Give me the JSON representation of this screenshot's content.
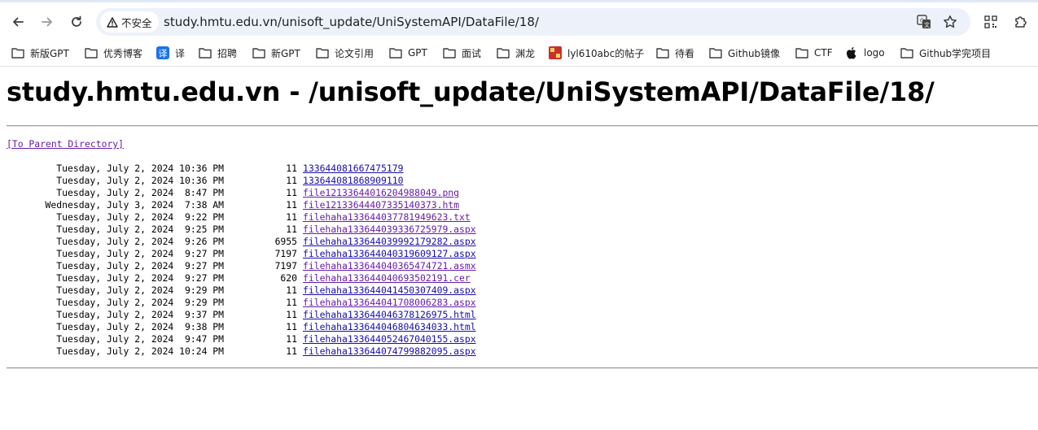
{
  "browser": {
    "security_chip": "不安全",
    "url": "study.hmtu.edu.vn/unisoft_update/UniSystemAPI/DataFile/18/"
  },
  "bookmarks": [
    {
      "label": "新版GPT",
      "icon": "folder-icon"
    },
    {
      "label": "优秀博客",
      "icon": "folder-icon"
    },
    {
      "label": "译",
      "icon": "translate-icon"
    },
    {
      "label": "招聘",
      "icon": "folder-icon"
    },
    {
      "label": "新GPT",
      "icon": "folder-icon"
    },
    {
      "label": "论文引用",
      "icon": "folder-icon"
    },
    {
      "label": "GPT",
      "icon": "folder-icon"
    },
    {
      "label": "面试",
      "icon": "folder-icon"
    },
    {
      "label": "渊龙",
      "icon": "folder-icon"
    },
    {
      "label": "lyl610abc的帖子",
      "icon": "site-icon"
    },
    {
      "label": "待看",
      "icon": "folder-icon"
    },
    {
      "label": "Github镜像",
      "icon": "folder-icon"
    },
    {
      "label": "CTF",
      "icon": "folder-icon"
    },
    {
      "label": "logo",
      "icon": "apple-icon"
    },
    {
      "label": "Github学完项目",
      "icon": "folder-icon"
    }
  ],
  "page": {
    "title": "study.hmtu.edu.vn - /unisoft_update/UniSystemAPI/DataFile/18/",
    "parent_link": "[To Parent Directory]",
    "files": [
      {
        "date": "Tuesday, July 2, 2024 10:36 PM",
        "size": "11",
        "name": "133644081667475179",
        "visited": false
      },
      {
        "date": "Tuesday, July 2, 2024 10:36 PM",
        "size": "11",
        "name": "133644081868909110",
        "visited": false
      },
      {
        "date": "Tuesday, July 2, 2024  8:47 PM",
        "size": "11",
        "name": "file12133644016204988049.png",
        "visited": true
      },
      {
        "date": "Wednesday, July 3, 2024  7:38 AM",
        "size": "11",
        "name": "file12133644407335140373.htm",
        "visited": true
      },
      {
        "date": "Tuesday, July 2, 2024  9:22 PM",
        "size": "11",
        "name": "filehaha133644037781949623.txt",
        "visited": true
      },
      {
        "date": "Tuesday, July 2, 2024  9:25 PM",
        "size": "11",
        "name": "filehaha133644039336725979.aspx",
        "visited": true
      },
      {
        "date": "Tuesday, July 2, 2024  9:26 PM",
        "size": "6955",
        "name": "filehaha133644039992179282.aspx",
        "visited": false
      },
      {
        "date": "Tuesday, July 2, 2024  9:27 PM",
        "size": "7197",
        "name": "filehaha133644040319609127.aspx",
        "visited": false
      },
      {
        "date": "Tuesday, July 2, 2024  9:27 PM",
        "size": "7197",
        "name": "filehaha133644040365474721.asmx",
        "visited": true
      },
      {
        "date": "Tuesday, July 2, 2024  9:27 PM",
        "size": "620",
        "name": "filehaha133644040693502191.cer",
        "visited": true
      },
      {
        "date": "Tuesday, July 2, 2024  9:29 PM",
        "size": "11",
        "name": "filehaha133644041450307409.aspx",
        "visited": false
      },
      {
        "date": "Tuesday, July 2, 2024  9:29 PM",
        "size": "11",
        "name": "filehaha133644041708006283.aspx",
        "visited": true
      },
      {
        "date": "Tuesday, July 2, 2024  9:37 PM",
        "size": "11",
        "name": "filehaha133644046378126975.html",
        "visited": false
      },
      {
        "date": "Tuesday, July 2, 2024  9:38 PM",
        "size": "11",
        "name": "filehaha133644046804634033.html",
        "visited": false
      },
      {
        "date": "Tuesday, July 2, 2024  9:47 PM",
        "size": "11",
        "name": "filehaha133644052467040155.aspx",
        "visited": false
      },
      {
        "date": "Tuesday, July 2, 2024 10:24 PM",
        "size": "11",
        "name": "filehaha133644074799882095.aspx",
        "visited": false
      }
    ]
  }
}
